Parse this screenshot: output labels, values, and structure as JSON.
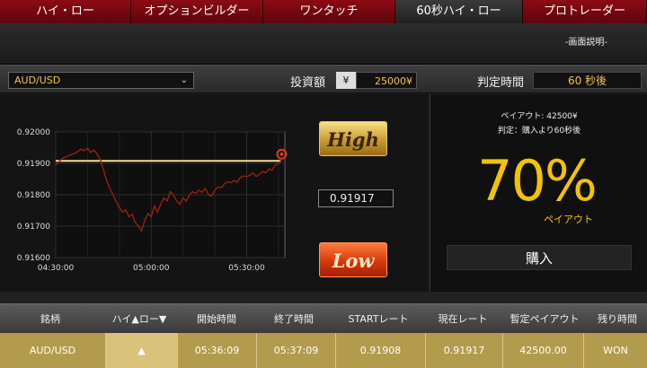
{
  "tabs": [
    {
      "label": "ハイ・ロー",
      "active": false
    },
    {
      "label": "オプションビルダー",
      "active": false
    },
    {
      "label": "ワンタッチ",
      "active": false
    },
    {
      "label": "60秒ハイ・ロー",
      "active": true
    },
    {
      "label": "プロトレーダー",
      "active": false
    }
  ],
  "manual_link": "-画面説明-",
  "controls": {
    "pair": "AUD/USD",
    "invest_label": "投資額",
    "currency": "¥",
    "amount": "25000¥",
    "judge_label": "判定時間",
    "judge_value": "60 秒後"
  },
  "trade": {
    "high_label": "High",
    "low_label": "Low",
    "current_rate": "0.91917"
  },
  "payout_panel": {
    "payout_line": "ペイアウト:  42500¥",
    "judge_line": "判定：購入より60秒後",
    "percent": "70%",
    "payout_sub": "ペイアウト",
    "buy_label": "購入"
  },
  "table": {
    "headers": [
      "銘柄",
      "ハイ▲ロー▼",
      "開始時間",
      "終了時間",
      "STARTレート",
      "現在レート",
      "暫定ペイアウト",
      "残り時間"
    ],
    "row": [
      "AUD/USD",
      "▲",
      "05:36:09",
      "05:37:09",
      "0.91908",
      "0.91917",
      "42500.00",
      "WON"
    ]
  },
  "colors": {
    "tab_red": "#8c0b14",
    "gold": "#f2c300",
    "line": "#a01f12",
    "strike": "#f4dca0"
  },
  "chart_data": {
    "type": "line",
    "yticks": [
      "0.92000",
      "0.91900",
      "0.91800",
      "0.91700",
      "0.91600"
    ],
    "xticks": [
      "04:30:00",
      "05:00:00",
      "05:30:00"
    ],
    "ylim": [
      0.916,
      0.92
    ],
    "xlim": [
      0,
      72
    ],
    "strike_rate": 0.91908,
    "series": [
      {
        "values": [
          [
            0,
            0.91895
          ],
          [
            2,
            0.91915
          ],
          [
            4,
            0.91925
          ],
          [
            6,
            0.91932
          ],
          [
            8,
            0.91945
          ],
          [
            9,
            0.9194
          ],
          [
            10,
            0.91948
          ],
          [
            11,
            0.91935
          ],
          [
            12,
            0.91942
          ],
          [
            13,
            0.9193
          ],
          [
            14,
            0.91912
          ],
          [
            15,
            0.9188
          ],
          [
            16,
            0.91845
          ],
          [
            17,
            0.9182
          ],
          [
            18,
            0.918
          ],
          [
            19,
            0.91778
          ],
          [
            20,
            0.9176
          ],
          [
            21,
            0.91745
          ],
          [
            22,
            0.91752
          ],
          [
            23,
            0.9173
          ],
          [
            24,
            0.91738
          ],
          [
            25,
            0.91712
          ],
          [
            26,
            0.917
          ],
          [
            27,
            0.91685
          ],
          [
            28,
            0.9172
          ],
          [
            29,
            0.9174
          ],
          [
            30,
            0.9173
          ],
          [
            31,
            0.91765
          ],
          [
            32,
            0.91745
          ],
          [
            33,
            0.9177
          ],
          [
            34,
            0.9179
          ],
          [
            35,
            0.9178
          ],
          [
            36,
            0.9181
          ],
          [
            37,
            0.918
          ],
          [
            38,
            0.9178
          ],
          [
            39,
            0.9177
          ],
          [
            40,
            0.9179
          ],
          [
            41,
            0.9178
          ],
          [
            42,
            0.918
          ],
          [
            43,
            0.9181
          ],
          [
            44,
            0.91805
          ],
          [
            45,
            0.91815
          ],
          [
            46,
            0.91808
          ],
          [
            47,
            0.9182
          ],
          [
            48,
            0.918
          ],
          [
            49,
            0.91795
          ],
          [
            50,
            0.91815
          ],
          [
            51,
            0.91825
          ],
          [
            52,
            0.91822
          ],
          [
            53,
            0.91835
          ],
          [
            54,
            0.91842
          ],
          [
            55,
            0.91838
          ],
          [
            56,
            0.91845
          ],
          [
            57,
            0.9184
          ],
          [
            58,
            0.91855
          ],
          [
            59,
            0.9186
          ],
          [
            60,
            0.91858
          ],
          [
            61,
            0.91862
          ],
          [
            62,
            0.9187
          ],
          [
            63,
            0.91858
          ],
          [
            64,
            0.91865
          ],
          [
            65,
            0.91875
          ],
          [
            66,
            0.9187
          ],
          [
            67,
            0.91882
          ],
          [
            68,
            0.91878
          ],
          [
            69,
            0.91895
          ],
          [
            70,
            0.919
          ],
          [
            71,
            0.91912
          ]
        ]
      }
    ]
  }
}
